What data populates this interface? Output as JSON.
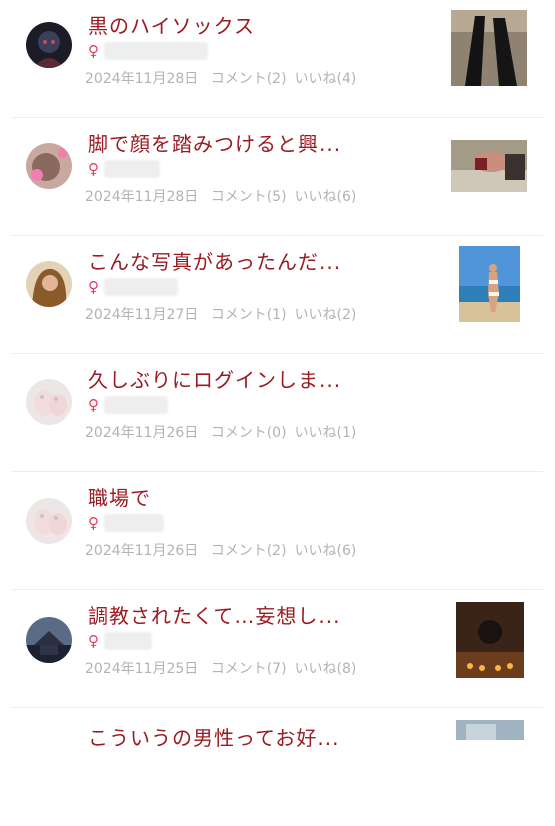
{
  "posts": [
    {
      "title": "黒のハイソックス",
      "gender": "♀",
      "date": "2024年11月28日",
      "comments": "コメント(2)",
      "likes": "いいね(4)",
      "avatar": "dark-anime-avatar",
      "thumb": "black-socks-legs-photo"
    },
    {
      "title": "脚で顔を踏みつけると興...",
      "gender": "♀",
      "date": "2024年11月28日",
      "comments": "コメント(5)",
      "likes": "いいね(6)",
      "avatar": "pink-flower-avatar",
      "thumb": "reclining-person-photo"
    },
    {
      "title": "こんな写真があったんだ...",
      "gender": "♀",
      "date": "2024年11月27日",
      "comments": "コメント(1)",
      "likes": "いいね(2)",
      "avatar": "brown-hair-avatar",
      "thumb": "beach-bikini-photo"
    },
    {
      "title": "久しぶりにログインしま...",
      "gender": "♀",
      "date": "2024年11月26日",
      "comments": "コメント(0)",
      "likes": "いいね(1)",
      "avatar": "pale-hand-avatar",
      "thumb": ""
    },
    {
      "title": "職場で",
      "gender": "♀",
      "date": "2024年11月26日",
      "comments": "コメント(2)",
      "likes": "いいね(6)",
      "avatar": "pale-hand-avatar",
      "thumb": ""
    },
    {
      "title": "調教されたくて…妄想し...",
      "gender": "♀",
      "date": "2024年11月25日",
      "comments": "コメント(7)",
      "likes": "いいね(8)",
      "avatar": "building-night-avatar",
      "thumb": "candlelit-room-photo"
    },
    {
      "title": "こういうの男性ってお好...",
      "gender": "♀",
      "date": "",
      "comments": "",
      "likes": "",
      "avatar": "",
      "thumb": "blue-fabric-photo"
    }
  ]
}
